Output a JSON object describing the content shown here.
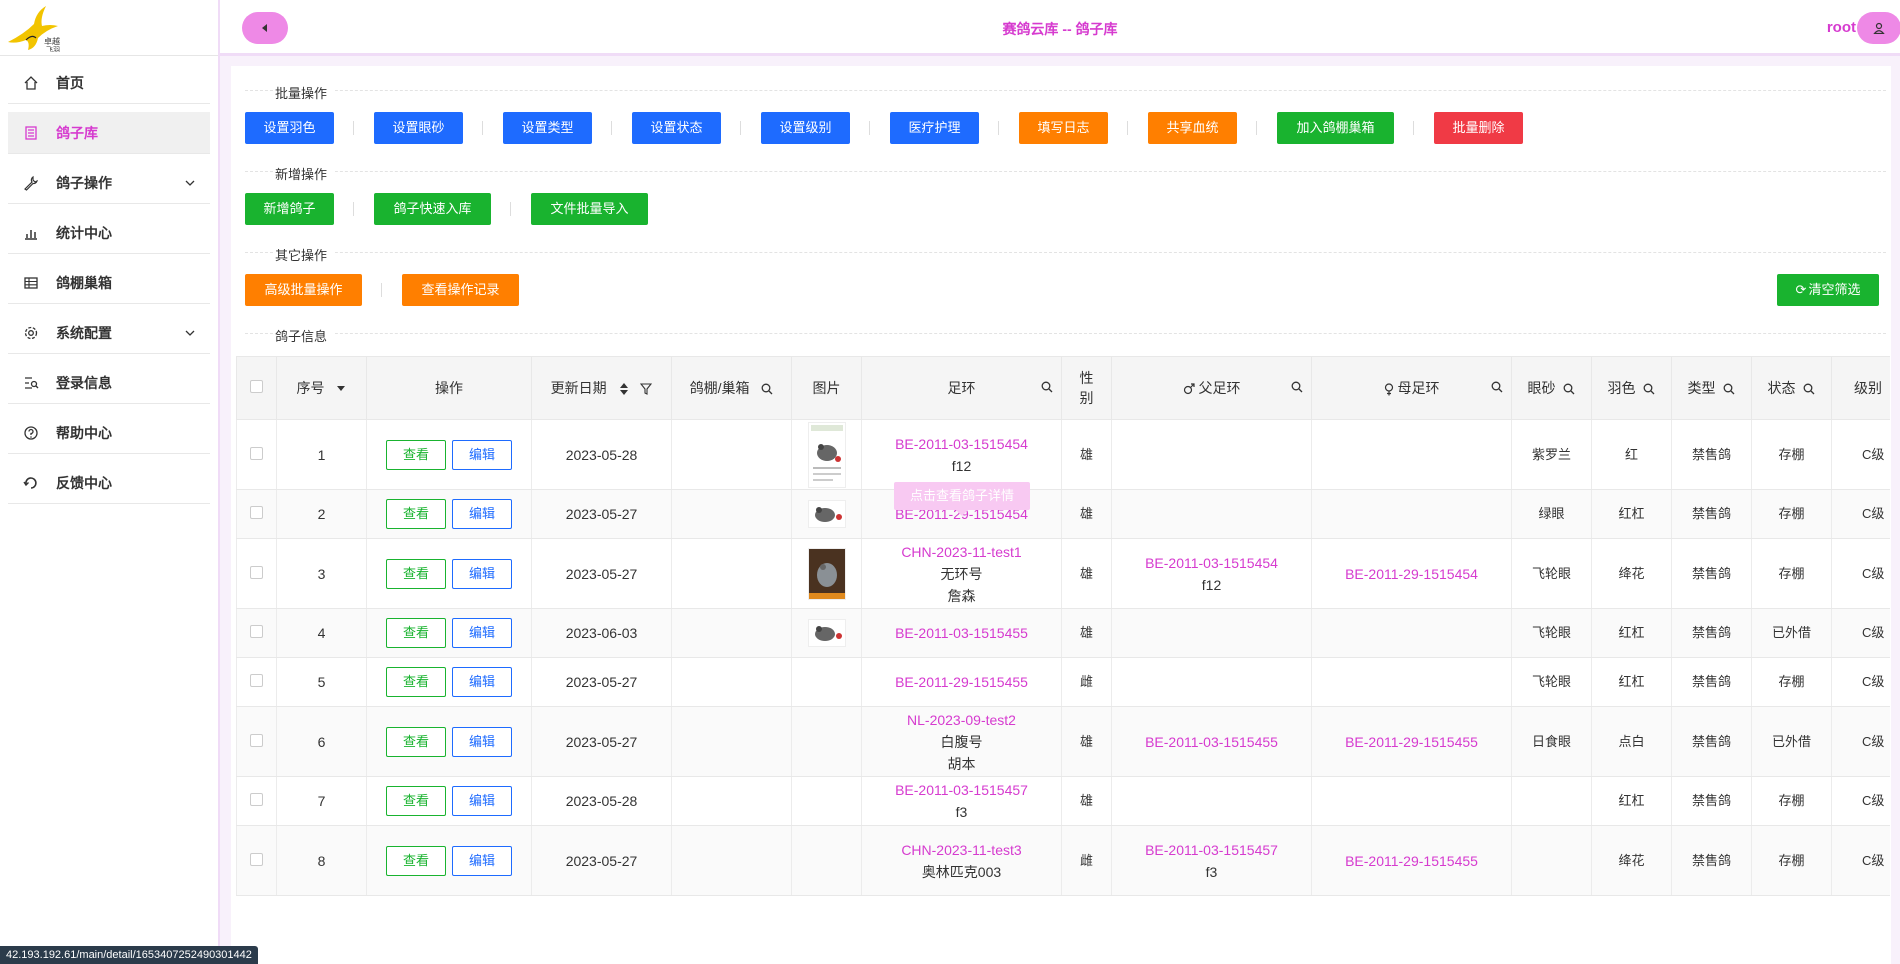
{
  "header": {
    "title": "赛鸽云库 -- 鸽子库",
    "user": "root"
  },
  "sidebar": {
    "items": [
      {
        "label": "首页",
        "icon": "home-icon",
        "active": false,
        "expandable": false
      },
      {
        "label": "鸽子库",
        "icon": "list-icon",
        "active": true,
        "expandable": false
      },
      {
        "label": "鸽子操作",
        "icon": "wrench-icon",
        "active": false,
        "expandable": true
      },
      {
        "label": "统计中心",
        "icon": "bar-chart-icon",
        "active": false,
        "expandable": false
      },
      {
        "label": "鸽棚巢箱",
        "icon": "table-icon",
        "active": false,
        "expandable": false
      },
      {
        "label": "系统配置",
        "icon": "gear-icon",
        "active": false,
        "expandable": true
      },
      {
        "label": "登录信息",
        "icon": "login-icon",
        "active": false,
        "expandable": false
      },
      {
        "label": "帮助中心",
        "icon": "help-icon",
        "active": false,
        "expandable": false
      },
      {
        "label": "反馈中心",
        "icon": "feedback-icon",
        "active": false,
        "expandable": false
      }
    ]
  },
  "sections": {
    "batch": "批量操作",
    "add": "新增操作",
    "other": "其它操作",
    "info": "鸽子信息"
  },
  "batch_buttons": [
    "设置羽色",
    "设置眼砂",
    "设置类型",
    "设置状态",
    "设置级别",
    "医疗护理",
    "填写日志",
    "共享血统",
    "加入鸽棚巢箱",
    "批量删除"
  ],
  "add_buttons": [
    "新增鸽子",
    "鸽子快速入库",
    "文件批量导入"
  ],
  "other_buttons": [
    "高级批量操作",
    "查看操作记录"
  ],
  "clear_filter": "清空筛选",
  "table": {
    "columns": [
      "序号",
      "操作",
      "更新日期",
      "鸽棚/巢箱",
      "图片",
      "足环",
      "性别",
      "父足环",
      "母足环",
      "眼砂",
      "羽色",
      "类型",
      "状态",
      "级别"
    ],
    "view_label": "查看",
    "edit_label": "编辑",
    "rows": [
      {
        "no": "1",
        "date": "2023-05-28",
        "ring": "BE-2011-03-1515454",
        "ring_sub": [
          "f12"
        ],
        "sex": "雄",
        "father": "",
        "father_sub": [],
        "mother": "",
        "eye": "紫罗兰",
        "color": "红",
        "type": "禁售鸽",
        "status": "存棚",
        "level": "C级",
        "img": "tall"
      },
      {
        "no": "2",
        "date": "2023-05-27",
        "ring": "BE-2011-29-1515454",
        "ring_sub": [],
        "sex": "雄",
        "father": "",
        "father_sub": [],
        "mother": "",
        "eye": "绿眼",
        "color": "红杠",
        "type": "禁售鸽",
        "status": "存棚",
        "level": "C级",
        "img": "small"
      },
      {
        "no": "3",
        "date": "2023-05-27",
        "ring": "CHN-2023-11-test1",
        "ring_sub": [
          "无环号",
          "詹森"
        ],
        "sex": "雄",
        "father": "BE-2011-03-1515454",
        "father_sub": [
          "f12"
        ],
        "mother": "BE-2011-29-1515454",
        "eye": "飞轮眼",
        "color": "绛花",
        "type": "禁售鸽",
        "status": "存棚",
        "level": "C级",
        "img": "dark"
      },
      {
        "no": "4",
        "date": "2023-06-03",
        "ring": "BE-2011-03-1515455",
        "ring_sub": [],
        "sex": "雄",
        "father": "",
        "father_sub": [],
        "mother": "",
        "eye": "飞轮眼",
        "color": "红杠",
        "type": "禁售鸽",
        "status": "已外借",
        "level": "C级",
        "img": "small"
      },
      {
        "no": "5",
        "date": "2023-05-27",
        "ring": "BE-2011-29-1515455",
        "ring_sub": [],
        "sex": "雌",
        "father": "",
        "father_sub": [],
        "mother": "",
        "eye": "飞轮眼",
        "color": "红杠",
        "type": "禁售鸽",
        "status": "存棚",
        "level": "C级",
        "img": ""
      },
      {
        "no": "6",
        "date": "2023-05-27",
        "ring": "NL-2023-09-test2",
        "ring_sub": [
          "白腹号",
          "胡本"
        ],
        "sex": "雄",
        "father": "BE-2011-03-1515455",
        "father_sub": [],
        "mother": "BE-2011-29-1515455",
        "eye": "日食眼",
        "color": "点白",
        "type": "禁售鸽",
        "status": "已外借",
        "level": "C级",
        "img": ""
      },
      {
        "no": "7",
        "date": "2023-05-28",
        "ring": "BE-2011-03-1515457",
        "ring_sub": [
          "f3"
        ],
        "sex": "雄",
        "father": "",
        "father_sub": [],
        "mother": "",
        "eye": "",
        "color": "红杠",
        "type": "禁售鸽",
        "status": "存棚",
        "level": "C级",
        "img": ""
      },
      {
        "no": "8",
        "date": "2023-05-27",
        "ring": "CHN-2023-11-test3",
        "ring_sub": [
          "奥林匹克003"
        ],
        "sex": "雌",
        "father": "BE-2011-03-1515457",
        "father_sub": [
          "f3"
        ],
        "mother": "BE-2011-29-1515455",
        "eye": "",
        "color": "绛花",
        "type": "禁售鸽",
        "status": "存棚",
        "level": "C级",
        "img": ""
      }
    ]
  },
  "tooltip": "点击查看鸽子详情",
  "status_url": "42.193.192.61/main/detail/1653407252490301442",
  "colors": {
    "accent": "#d63bcf",
    "pink": "#ee89e6",
    "blue": "#1e6bff",
    "orange": "#ff7f00",
    "green": "#19b32f",
    "red": "#f03a45"
  }
}
